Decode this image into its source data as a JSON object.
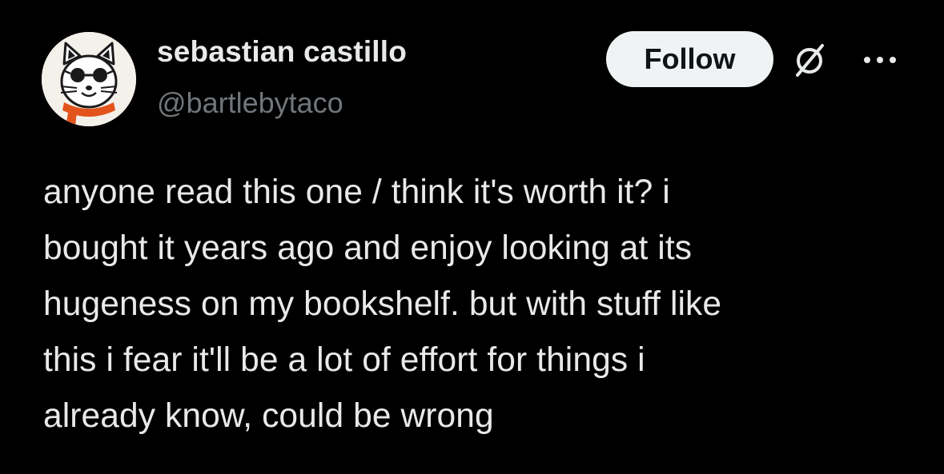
{
  "author": {
    "display_name": "sebastian castillo",
    "handle": "@bartlebytaco",
    "avatar_icon": "cartoon-cat-with-glasses-and-scarf-avatar"
  },
  "actions": {
    "follow_label": "Follow",
    "grok_icon": "slashed-circle-icon",
    "more_icon": "more-dots-icon"
  },
  "post": {
    "text": "anyone read this one / think it's worth it? i\nbought it years ago and enjoy looking at its\nhugeness on my bookshelf. but with stuff like\nthis i fear it'll be a lot of effort for things i\nalready know, could be wrong"
  },
  "colors": {
    "background": "#000000",
    "primary_text": "#e7e9ea",
    "secondary_text": "#71767b",
    "follow_button_bg": "#eff3f4",
    "follow_button_text": "#0f1419"
  }
}
